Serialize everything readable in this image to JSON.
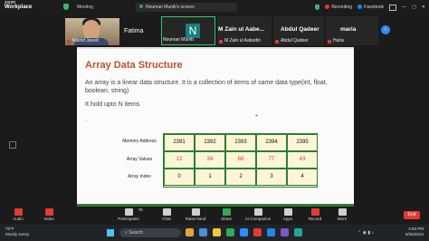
{
  "app": {
    "brand_line1": "zoom",
    "brand_line2": "Workplace",
    "meeting_label": "Meeting"
  },
  "screen_share_label": "Nouman Munib's screen",
  "status": {
    "recording": "Recording",
    "account": "Facebook"
  },
  "participants": [
    {
      "name": "Kashif Javed",
      "type": "video"
    },
    {
      "name": "Fatima",
      "type": "name"
    },
    {
      "name": "Nouman Munib",
      "initial": "N",
      "type": "avatar"
    },
    {
      "name": "M Zain ul Aabe...",
      "subname": "M Zain ul Aabedin",
      "type": "name"
    },
    {
      "name": "Abdul Qadeer",
      "subname": "Abdul Qadeer",
      "type": "name"
    },
    {
      "name": "maria",
      "subname": "Haria",
      "type": "name"
    }
  ],
  "slide": {
    "title": "Array Data Structure",
    "paragraph": "An array is a linear data structure. It is a collection of items of same data type(int, float, boolean, string)",
    "line2": "It hold upto N items",
    "bullet": ".",
    "row_labels": [
      "Memory Address",
      "Array Values",
      "Array Index"
    ],
    "addresses": [
      "2391",
      "2392",
      "2393",
      "2394",
      "2395"
    ],
    "values": [
      "12",
      "34",
      "68",
      "77",
      "43"
    ],
    "indices": [
      "0",
      "1",
      "2",
      "3",
      "4"
    ],
    "colors": {
      "title": "#c0502a",
      "value": "#d84315",
      "border": "#2e7d32",
      "cell_bg": "#fcf6d6"
    }
  },
  "toolbar": {
    "audio": "Audio",
    "video": "Video",
    "participants": "Participants",
    "participants_count": "78",
    "chat": "Chat",
    "raise_hand": "Raise hand",
    "share": "Share",
    "ai_companion": "AI Companion",
    "apps": "Apps",
    "record": "Record",
    "more": "More",
    "end": "End"
  },
  "taskbar": {
    "weather_temp": "78°F",
    "weather_desc": "Mostly sunny",
    "search_placeholder": "Search",
    "time": "4:50 PM",
    "date": "6/25/2024"
  }
}
